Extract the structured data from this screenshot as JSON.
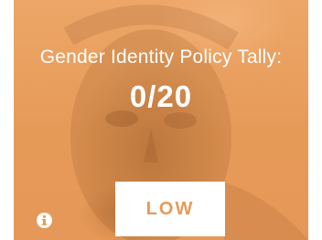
{
  "card": {
    "title": "Gender Identity Policy Tally:",
    "score": "0/20",
    "level_label": "LOW",
    "info_icon": "info-icon",
    "background_image": "portrait-photo",
    "accent_color": "#e9a160"
  }
}
